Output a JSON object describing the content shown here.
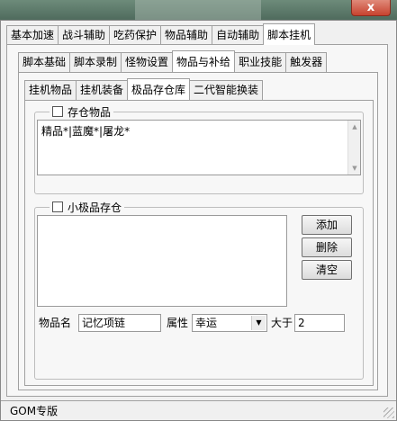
{
  "window": {
    "close_glyph": "x"
  },
  "main_tabs": [
    "基本加速",
    "战斗辅助",
    "吃药保护",
    "物品辅助",
    "自动辅助",
    "脚本挂机"
  ],
  "sub_tabs": [
    "脚本基础",
    "脚本录制",
    "怪物设置",
    "物品与补给",
    "职业技能",
    "触发器"
  ],
  "inner_tabs": [
    "挂机物品",
    "挂机装备",
    "极品存仓库",
    "二代智能换装"
  ],
  "store_group": {
    "label": "存仓物品",
    "checked": false,
    "text": "精品*|蓝魔*|屠龙*"
  },
  "small_group": {
    "label": "小极品存仓",
    "checked": false
  },
  "buttons": {
    "add": "添加",
    "delete": "删除",
    "clear": "清空"
  },
  "item_name": {
    "label": "物品名",
    "value": "记忆项链"
  },
  "attribute": {
    "label": "属性",
    "value": "幸运"
  },
  "greater": {
    "label": "大于",
    "value": "2"
  },
  "status": "GOM专版"
}
